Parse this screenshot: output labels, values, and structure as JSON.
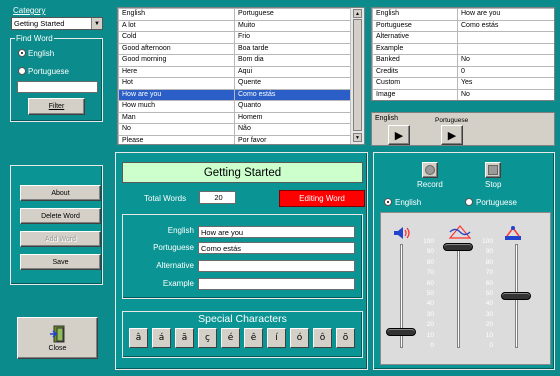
{
  "category": {
    "label": "Category",
    "value": "Getting Started"
  },
  "find_word": {
    "label": "Find Word",
    "options": [
      "English",
      "Portuguese"
    ],
    "selected": "English",
    "input_value": "",
    "filter_label": "Filter"
  },
  "actions": {
    "about": "About",
    "delete_word": "Delete Word",
    "add_word": "Add Word",
    "save": "Save",
    "close": "Close"
  },
  "word_list": {
    "columns": [
      "English",
      "Portuguese"
    ],
    "rows": [
      [
        "A lot",
        "Muito"
      ],
      [
        "Cold",
        "Frio"
      ],
      [
        "Good afternoon",
        "Boa tarde"
      ],
      [
        "Good morning",
        "Bom dia"
      ],
      [
        "Here",
        "Aqui"
      ],
      [
        "Hot",
        "Quente"
      ],
      [
        "How are you",
        "Como estás"
      ],
      [
        "How much",
        "Quanto"
      ],
      [
        "Man",
        "Homem"
      ],
      [
        "No",
        "Não"
      ],
      [
        "Please",
        "Por favor"
      ]
    ],
    "selected_index": 6
  },
  "details": {
    "rows": [
      [
        "English",
        "How are you"
      ],
      [
        "Portuguese",
        "Como estás"
      ],
      [
        "Alternative",
        ""
      ],
      [
        "Example",
        ""
      ],
      [
        "Banked",
        "No"
      ],
      [
        "Credits",
        "0"
      ],
      [
        "Custom",
        "Yes"
      ],
      [
        "Image",
        "No"
      ]
    ]
  },
  "play": {
    "english": "English",
    "portuguese": "Portuguese"
  },
  "editor": {
    "category_title": "Getting Started",
    "total_words_label": "Total Words",
    "total_words": "20",
    "status": "Editing Word",
    "fields": [
      {
        "label": "English",
        "value": "How are you"
      },
      {
        "label": "Portuguese",
        "value": "Como estás"
      },
      {
        "label": "Alternative",
        "value": ""
      },
      {
        "label": "Example",
        "value": ""
      }
    ]
  },
  "special_chars": {
    "title": "Special Characters",
    "chars": [
      "â",
      "á",
      "ã",
      "ç",
      "é",
      "ê",
      "í",
      "ó",
      "ô",
      "õ"
    ]
  },
  "recorder": {
    "record": "Record",
    "stop": "Stop",
    "options": [
      "English",
      "Portuguese"
    ],
    "selected": "English",
    "scale": [
      "100",
      "90",
      "80",
      "70",
      "60",
      "50",
      "40",
      "30",
      "20",
      "10",
      "0"
    ],
    "volume_level": 0.15,
    "pitch_level": 0.97,
    "speed_level": 0.5
  },
  "colors": {
    "background": "#0b8b8b",
    "status_bg": "#ff0000",
    "title_bg": "#ccffcc",
    "selection": "#2b5fc7"
  }
}
